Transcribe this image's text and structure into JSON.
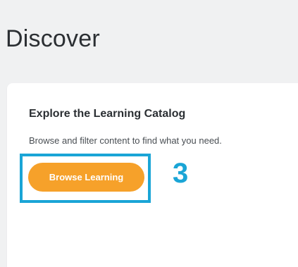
{
  "page": {
    "title": "Discover"
  },
  "card": {
    "title": "Explore the Learning Catalog",
    "description": "Browse and filter content to find what you need.",
    "button_label": "Browse Learning"
  },
  "annotation": {
    "step_number": "3",
    "highlight_color": "#1aa5d6"
  },
  "colors": {
    "page_background": "#f0f1f2",
    "card_background": "#ffffff",
    "button_background": "#f6a12a",
    "button_text": "#ffffff"
  }
}
